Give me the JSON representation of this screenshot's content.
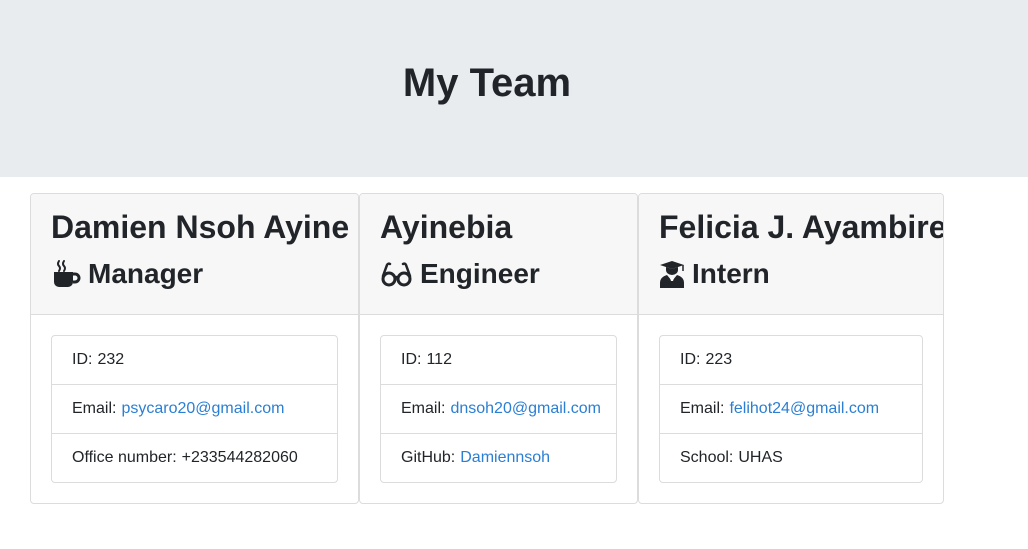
{
  "header": {
    "title": "My Team"
  },
  "team": [
    {
      "name": "Damien Nsoh Ayine",
      "role": "Manager",
      "role_icon": "mug-icon",
      "id_label": "ID:",
      "id": "232",
      "email_label": "Email:",
      "email": "psycaro20@gmail.com",
      "extra_label": "Office number:",
      "extra": "+233544282060"
    },
    {
      "name": "Ayinebia",
      "role": "Engineer",
      "role_icon": "glasses-icon",
      "id_label": "ID:",
      "id": "112",
      "email_label": "Email:",
      "email": "dnsoh20@gmail.com",
      "extra_label": "GitHub:",
      "extra": "Damiennsoh"
    },
    {
      "name": "Felicia J. Ayambire",
      "role": "Intern",
      "role_icon": "graduate-icon",
      "id_label": "ID:",
      "id": "223",
      "email_label": "Email:",
      "email": "felihot24@gmail.com",
      "extra_label": "School:",
      "extra": "UHAS"
    }
  ],
  "colors": {
    "jumbotron": "#e9ecef",
    "card_header": "#f7f7f7",
    "link": "#2a7fd4",
    "text": "#212529"
  }
}
